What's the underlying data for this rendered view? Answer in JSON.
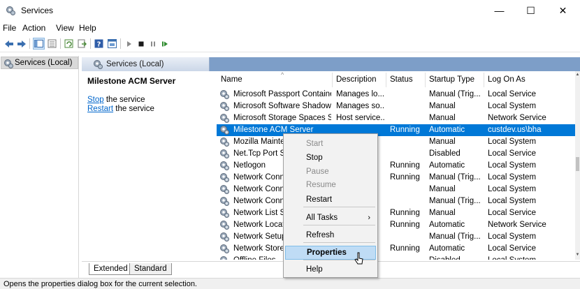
{
  "window": {
    "title": "Services",
    "controls": {
      "minimize": "—",
      "maximize": "☐",
      "close": "✕"
    }
  },
  "menu": [
    "File",
    "Action",
    "View",
    "Help"
  ],
  "toolbar_icons": [
    "back-icon",
    "forward-icon",
    "console-tree-icon",
    "properties-icon",
    "refresh-icon",
    "export-list-icon",
    "help-icon",
    "console-icon",
    "start-service-icon",
    "stop-service-icon",
    "pause-service-icon",
    "restart-service-icon"
  ],
  "tree": {
    "label": "Services (Local)"
  },
  "panel": {
    "tab_label": "Services (Local)"
  },
  "details": {
    "service_name": "Milestone ACM Server",
    "actions": [
      {
        "link": "Stop",
        "rest": " the service"
      },
      {
        "link": "Restart",
        "rest": " the service"
      }
    ]
  },
  "columns": {
    "name": "Name",
    "description": "Description",
    "status": "Status",
    "startup_type": "Startup Type",
    "log_on_as": "Log On As"
  },
  "rows": [
    {
      "name": "Microsoft Passport Container",
      "description": "Manages lo...",
      "status": "",
      "startup": "Manual (Trig...",
      "logon": "Local Service",
      "selected": false
    },
    {
      "name": "Microsoft Software Shadow...",
      "description": "Manages so...",
      "status": "",
      "startup": "Manual",
      "logon": "Local System",
      "selected": false
    },
    {
      "name": "Microsoft Storage Spaces S...",
      "description": "Host service...",
      "status": "",
      "startup": "Manual",
      "logon": "Network Service",
      "selected": false
    },
    {
      "name": "Milestone ACM Server",
      "description": "",
      "status": "Running",
      "startup": "Automatic",
      "logon": "custdev.us\\bha",
      "selected": true
    },
    {
      "name": "Mozilla Mainter",
      "description": "...",
      "status": "",
      "startup": "Manual",
      "logon": "Local System",
      "selected": false
    },
    {
      "name": "Net.Tcp Port Sh",
      "description": "...",
      "status": "",
      "startup": "Disabled",
      "logon": "Local Service",
      "selected": false
    },
    {
      "name": "Netlogon",
      "description": "...",
      "status": "Running",
      "startup": "Automatic",
      "logon": "Local System",
      "selected": false
    },
    {
      "name": "Network Conne",
      "description": "...",
      "status": "Running",
      "startup": "Manual (Trig...",
      "logon": "Local System",
      "selected": false
    },
    {
      "name": "Network Conne",
      "description": ".",
      "status": "",
      "startup": "Manual",
      "logon": "Local System",
      "selected": false
    },
    {
      "name": "Network Conne",
      "description": ".",
      "status": "",
      "startup": "Manual (Trig...",
      "logon": "Local System",
      "selected": false
    },
    {
      "name": "Network List Se",
      "description": "..",
      "status": "Running",
      "startup": "Manual",
      "logon": "Local Service",
      "selected": false
    },
    {
      "name": "Network Locati",
      "description": "..",
      "status": "Running",
      "startup": "Automatic",
      "logon": "Network Service",
      "selected": false
    },
    {
      "name": "Network Setup",
      "description": "...",
      "status": "",
      "startup": "Manual (Trig...",
      "logon": "Local System",
      "selected": false
    },
    {
      "name": "Network Store I",
      "description": "...",
      "status": "Running",
      "startup": "Automatic",
      "logon": "Local Service",
      "selected": false
    },
    {
      "name": "Offline Files",
      "description": "",
      "status": "",
      "startup": "Disabled",
      "logon": "Local System",
      "selected": false
    }
  ],
  "context_menu": [
    {
      "label": "Start",
      "disabled": true
    },
    {
      "label": "Stop",
      "disabled": false
    },
    {
      "label": "Pause",
      "disabled": true
    },
    {
      "label": "Resume",
      "disabled": true
    },
    {
      "label": "Restart",
      "disabled": false
    },
    {
      "label": "All Tasks",
      "disabled": false,
      "submenu": true
    },
    {
      "label": "Refresh",
      "disabled": false
    },
    {
      "label": "Properties",
      "disabled": false,
      "highlighted": true
    },
    {
      "label": "Help",
      "disabled": false
    }
  ],
  "view_tabs": {
    "extended": "Extended",
    "standard": "Standard"
  },
  "status_bar": "Opens the properties dialog box for the current selection.",
  "colors": {
    "selection": "#0078d7",
    "menu_highlight": "#bfdcf5",
    "panel_header": "#7d9ec8",
    "link": "#0066cc"
  }
}
